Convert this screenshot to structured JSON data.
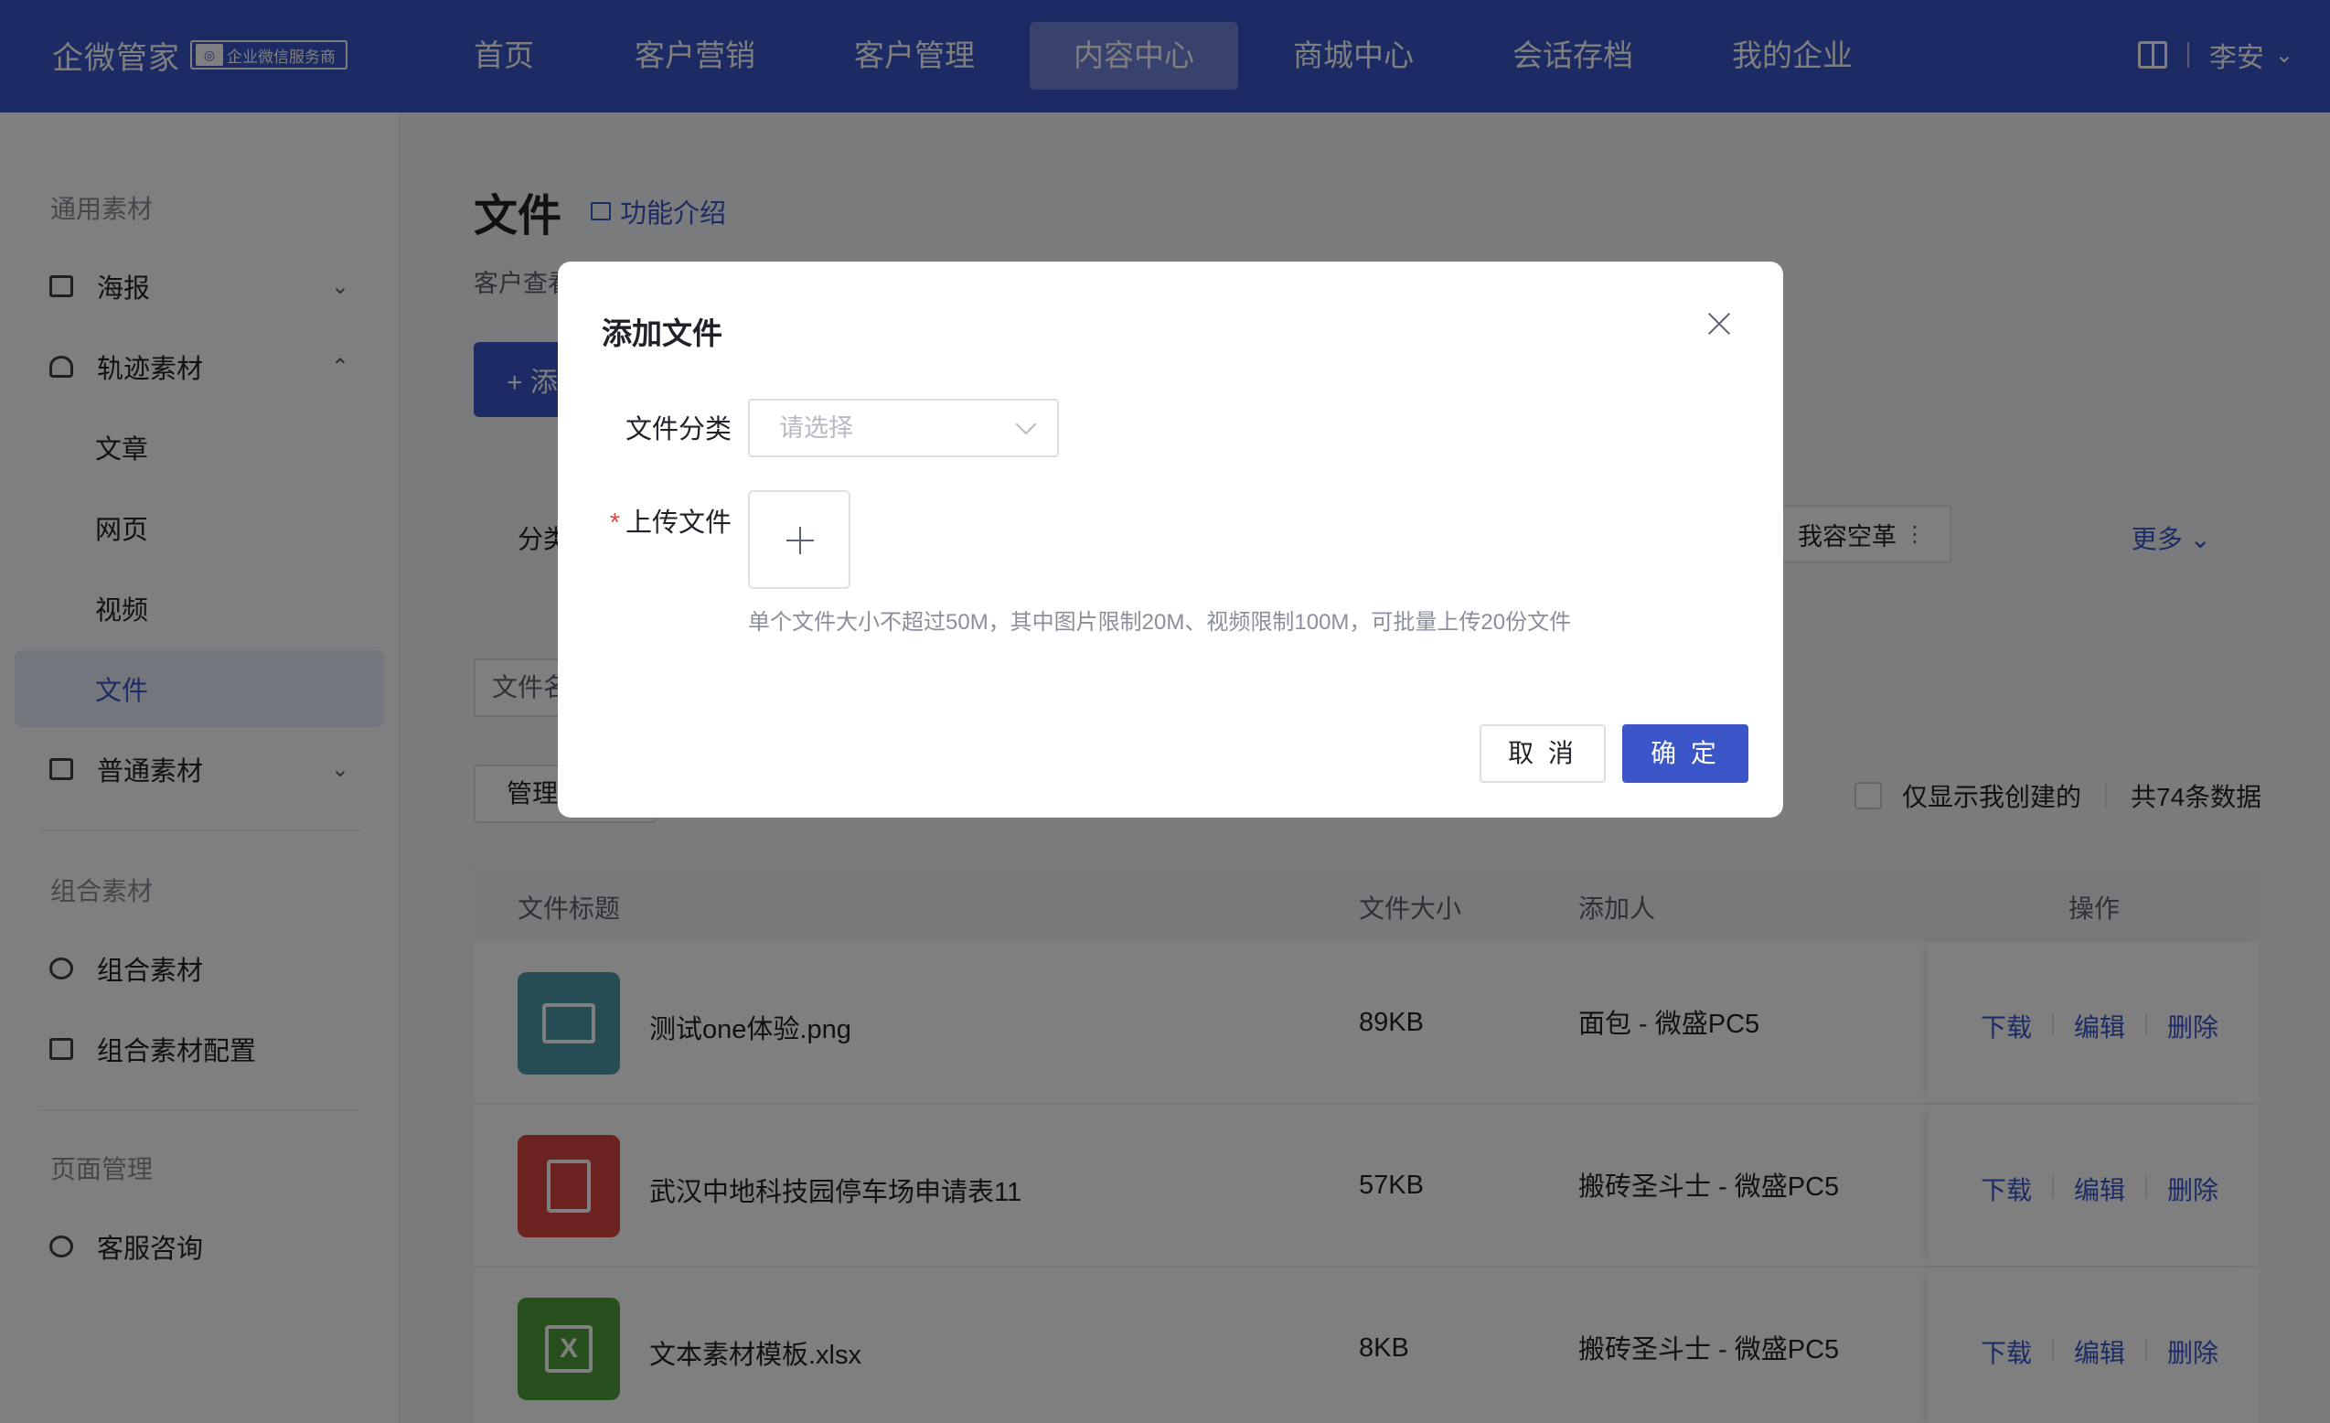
{
  "topbar": {
    "brand": "企微管家",
    "badge_text": "企业微信服务商",
    "nav": [
      "首页",
      "客户营销",
      "客户管理",
      "内容中心",
      "商城中心",
      "会话存档",
      "我的企业"
    ],
    "active_nav": "内容中心",
    "user_name": "李安"
  },
  "sidebar": {
    "group_general": "通用素材",
    "poster": "海报",
    "track": "轨迹素材",
    "article": "文章",
    "webpage": "网页",
    "video": "视频",
    "file": "文件",
    "normal": "普通素材",
    "group_combo": "组合素材",
    "combo": "组合素材",
    "combo_config": "组合素材配置",
    "group_page": "页面管理",
    "service": "客服咨询"
  },
  "main": {
    "title": "文件",
    "intro_link": "功能介绍",
    "subdesc": "客户查看",
    "add_button": "+ 添",
    "filter_label": "分类",
    "filter_tag": "我容空革",
    "filter_more": "更多",
    "search_placeholder": "文件名",
    "manage_button": "管理",
    "only_mine": "仅显示我创建的",
    "total": "共74条数据"
  },
  "table": {
    "headers": {
      "title": "文件标题",
      "size": "文件大小",
      "creator": "添加人",
      "ops": "操作"
    },
    "rows": [
      {
        "name": "测试one体验.png",
        "size": "89KB",
        "creator": "面包 - 微盛PC5",
        "icon_color": "#4f9aa8",
        "icon": "image-icon"
      },
      {
        "name": "武汉中地科技园停车场申请表11",
        "size": "57KB",
        "creator": "搬砖圣斗士 - 微盛PC5",
        "icon_color": "#d9443e",
        "icon": "pdf-icon"
      },
      {
        "name": "文本素材模板.xlsx",
        "size": "8KB",
        "creator": "搬砖圣斗士 - 微盛PC5",
        "icon_color": "#4c9e3a",
        "icon": "excel-icon"
      }
    ],
    "ops": {
      "download": "下载",
      "edit": "编辑",
      "delete": "删除"
    }
  },
  "modal": {
    "title": "添加文件",
    "category_label": "文件分类",
    "category_placeholder": "请选择",
    "upload_label": "上传文件",
    "upload_tip": "单个文件大小不超过50M，其中图片限制20M、视频限制100M，可批量上传20份文件",
    "cancel": "取 消",
    "ok": "确 定"
  },
  "colors": {
    "primary": "#3a56c9",
    "required": "#e0463d"
  }
}
